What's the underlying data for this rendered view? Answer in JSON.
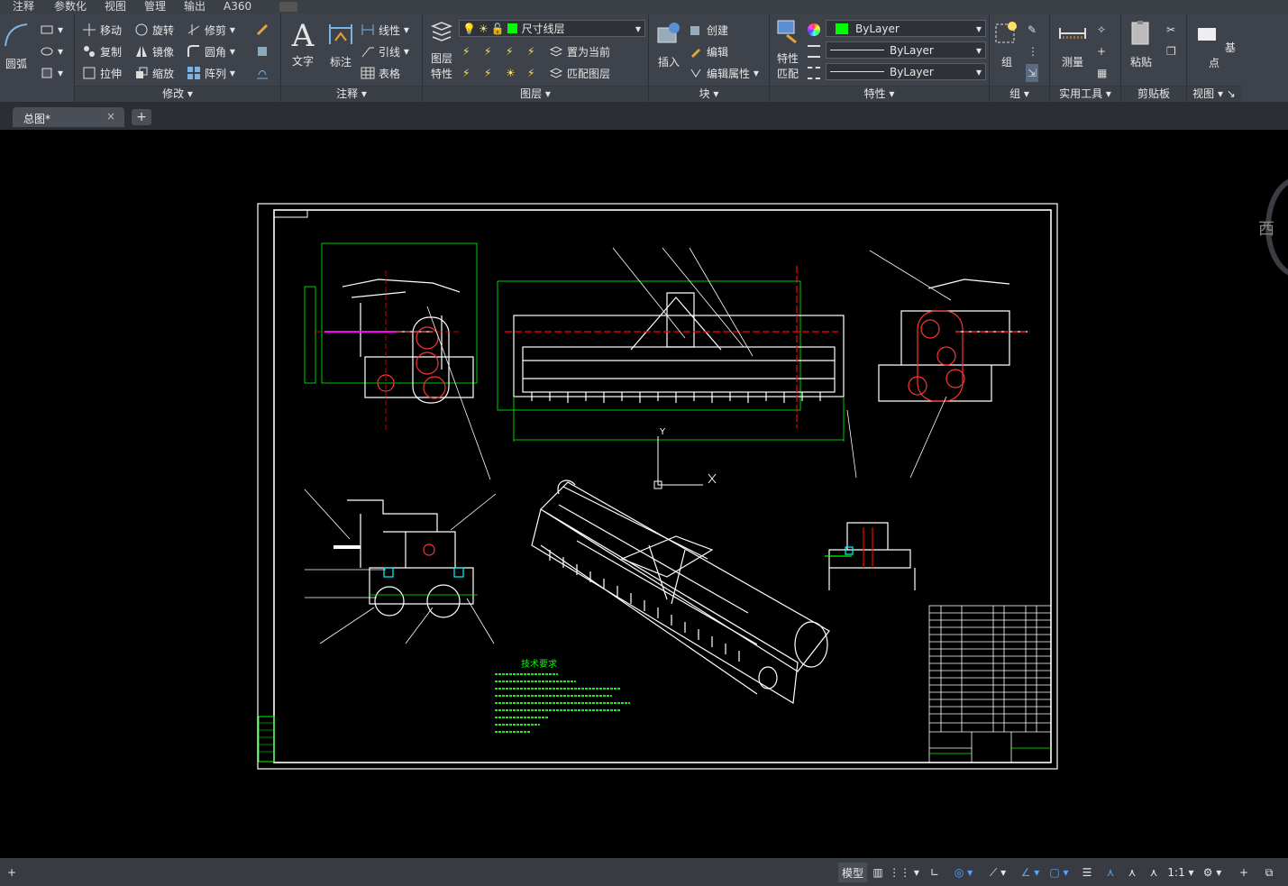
{
  "menu": [
    "注释",
    "参数化",
    "视图",
    "管理",
    "输出",
    "A360"
  ],
  "panels": {
    "draw": {
      "arc": "圆弧"
    },
    "modify": {
      "title": "修改",
      "move": "移动",
      "rotate": "旋转",
      "trim": "修剪",
      "copy": "复制",
      "mirror": "镜像",
      "fillet": "圆角",
      "stretch": "拉伸",
      "scale": "缩放",
      "array": "阵列"
    },
    "annotation": {
      "title": "注释",
      "text": "文字",
      "dimension": "标注",
      "linear": "线性",
      "leader": "引线",
      "table": "表格"
    },
    "layers": {
      "title": "图层",
      "props_line1": "图层",
      "props_line2": "特性",
      "layer_name": "尺寸线层",
      "set_current": "置为当前",
      "match_layer": "匹配图层"
    },
    "block": {
      "title": "块",
      "insert": "插入",
      "create": "创建",
      "edit": "编辑",
      "edit_attr": "编辑属性"
    },
    "properties": {
      "title": "特性",
      "match_line1": "特性",
      "match_line2": "匹配",
      "color": "ByLayer",
      "linetype": "ByLayer",
      "lineweight": "ByLayer"
    },
    "groups": {
      "title": "组",
      "group": "组"
    },
    "utilities": {
      "title": "实用工具",
      "measure": "测量"
    },
    "clipboard": {
      "title": "剪贴板",
      "paste": "粘贴"
    },
    "view": {
      "title": "视图",
      "basepoint": "基点"
    }
  },
  "doc_tab": {
    "name": "总图*"
  },
  "canvas": {
    "viewcube_label": "西",
    "tech_title": "技术要求",
    "ucs_y": "Y"
  },
  "status": {
    "model": "模型",
    "scale": "1:1"
  },
  "colors": {
    "accent_green": "#00ff00",
    "cad_bg": "#000000",
    "ribbon_bg": "#3e434b"
  }
}
